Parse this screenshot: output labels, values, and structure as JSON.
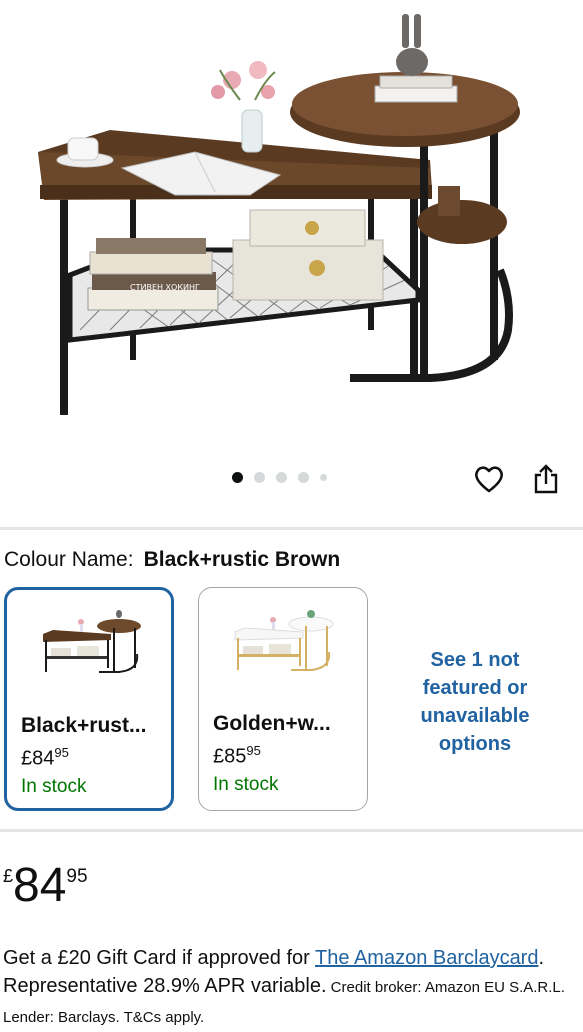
{
  "gallery": {
    "image_alt": "Coffee table with side table",
    "book_spine_text": "СТИВЕН ХОКИНГ",
    "dots_count": 5,
    "active_dot": 1
  },
  "actions": {
    "wishlist_icon": "heart-icon",
    "share_icon": "share-icon"
  },
  "variation": {
    "label": "Colour Name:",
    "selected_value": "Black+rustic Brown",
    "options": [
      {
        "name": "Black+rust...",
        "currency": "£",
        "whole": "84",
        "fraction": "95",
        "stock": "In stock",
        "selected": true
      },
      {
        "name": "Golden+w...",
        "currency": "£",
        "whole": "85",
        "fraction": "95",
        "stock": "In stock",
        "selected": false
      }
    ],
    "see_more_lines": [
      "See 1 not",
      "featured or",
      "unavailable",
      "options"
    ]
  },
  "price": {
    "currency": "£",
    "whole": "84",
    "fraction": "95"
  },
  "offer": {
    "text_before_link": "Get a £20 Gift Card if approved for ",
    "link_text": "The Amazon Barclaycard",
    "text_after_link": ". Representative 28.9% APR variable.",
    "small_text": " Credit broker: Amazon EU S.A.R.L. Lender: Barclays. T&Cs apply."
  },
  "colors": {
    "link": "#2162a1",
    "in_stock": "#007600",
    "selected_border": "#2162a1"
  }
}
